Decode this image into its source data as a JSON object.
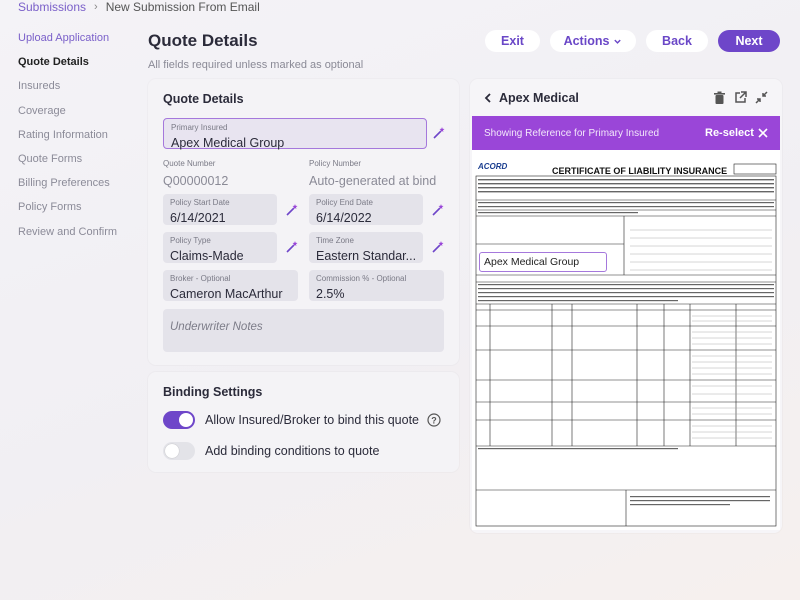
{
  "breadcrumb": {
    "parent": "Submissions",
    "current": "New Submission From Email"
  },
  "sidebar": {
    "items": [
      {
        "label": "Upload Application"
      },
      {
        "label": "Quote Details"
      },
      {
        "label": "Insureds"
      },
      {
        "label": "Coverage"
      },
      {
        "label": "Rating Information"
      },
      {
        "label": "Quote Forms"
      },
      {
        "label": "Billing Preferences"
      },
      {
        "label": "Policy Forms"
      },
      {
        "label": "Review and Confirm"
      }
    ]
  },
  "header": {
    "title": "Quote Details",
    "subtitle": "All fields required unless marked as optional"
  },
  "actions": {
    "exit": "Exit",
    "actions": "Actions",
    "back": "Back",
    "next": "Next"
  },
  "quote_card": {
    "title": "Quote Details",
    "primary_insured": {
      "label": "Primary Insured",
      "value": "Apex Medical Group"
    },
    "quote_number": {
      "label": "Quote Number",
      "value": "Q00000012"
    },
    "policy_number": {
      "label": "Policy Number",
      "value": "Auto-generated at bind"
    },
    "policy_start": {
      "label": "Policy Start Date",
      "value": "6/14/2021"
    },
    "policy_end": {
      "label": "Policy End Date",
      "value": "6/14/2022"
    },
    "policy_type": {
      "label": "Policy Type",
      "value": "Claims-Made"
    },
    "time_zone": {
      "label": "Time Zone",
      "value": "Eastern Standar..."
    },
    "broker": {
      "label": "Broker - Optional",
      "value": "Cameron MacArthur"
    },
    "commission": {
      "label": "Commission % - Optional",
      "value": "2.5%"
    },
    "notes_placeholder": "Underwriter Notes"
  },
  "binding_card": {
    "title": "Binding Settings",
    "allow_bind_label": "Allow Insured/Broker to bind this quote",
    "allow_bind_on": true,
    "conditions_label": "Add binding conditions to quote",
    "conditions_on": false
  },
  "doc_panel": {
    "title": "Apex Medical",
    "reference_msg": "Showing Reference for Primary Insured",
    "reselect": "Re-select",
    "acord_logo": "ACORD",
    "doc_title": "CERTIFICATE OF LIABILITY INSURANCE",
    "insured_value": "Apex Medical Group",
    "colors": {
      "accent": "#9a46d8"
    }
  },
  "colors": {
    "primary": "#6e46c9",
    "link": "#7a5fc9"
  }
}
